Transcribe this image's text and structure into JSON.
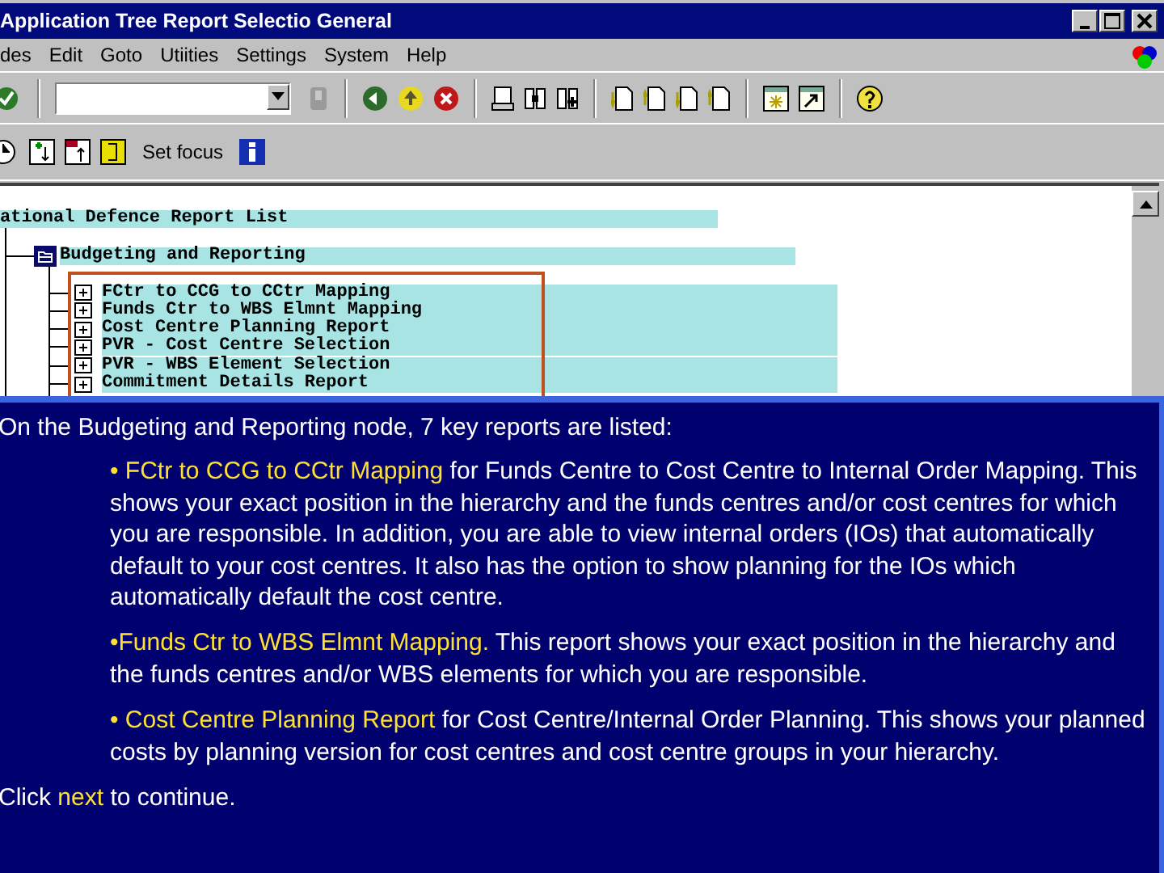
{
  "window": {
    "title": "Application Tree Report Selectio General"
  },
  "menu": [
    "des",
    "Edit",
    "Goto",
    "Utiities",
    "Settings",
    "System",
    "Help"
  ],
  "app_toolbar": {
    "label": "Set focus"
  },
  "tree": {
    "root": "ational Defence Report List",
    "children": [
      {
        "label": "Budgeting and Reporting",
        "expanded": true,
        "children": [
          {
            "label": "FCtr to CCG to CCtr Mapping",
            "expanded": false
          },
          {
            "label": "Funds Ctr to WBS Elmnt Mapping",
            "expanded": false
          },
          {
            "label": "Cost Centre Planning Report",
            "expanded": false
          },
          {
            "label": "PVR - Cost Centre Selection",
            "expanded": false
          },
          {
            "label": "PVR - WBS Element Selection",
            "expanded": false
          },
          {
            "label": "Commitment Details Report",
            "expanded": false
          }
        ]
      }
    ]
  },
  "overlay": {
    "intro": "On the Budgeting and Reporting node, 7 key reports are listed:",
    "bullets": [
      {
        "segments": [
          {
            "text": "• FCtr to CCG to CCtr Mapping",
            "highlight": true
          },
          {
            "text": " for Funds Centre to Cost Centre to Internal Order Mapping.  This shows your exact position in the hierarchy and the funds centres and/or cost centres for which you are responsible. In addition, you are able to view internal orders (IOs) that automatically default to your cost centres. It also has the option to show planning for the IOs which automatically default the cost centre.",
            "highlight": false
          }
        ]
      },
      {
        "segments": [
          {
            "text": "•Funds Ctr to WBS Elmnt Mapping.",
            "highlight": true
          },
          {
            "text": " This report shows your exact position in the hierarchy and the funds centres and/or WBS elements for which you are responsible.",
            "highlight": false
          }
        ]
      },
      {
        "segments": [
          {
            "text": "• Cost Centre Planning Report",
            "highlight": true
          },
          {
            "text": " for Cost Centre/Internal Order Planning.  This shows your planned costs by planning version for cost centres and cost centre groups in your hierarchy.",
            "highlight": false
          }
        ]
      }
    ],
    "footer": [
      {
        "text": "Click ",
        "highlight": false
      },
      {
        "text": "next",
        "highlight": true
      },
      {
        "text": " to continue.",
        "highlight": false
      }
    ]
  }
}
